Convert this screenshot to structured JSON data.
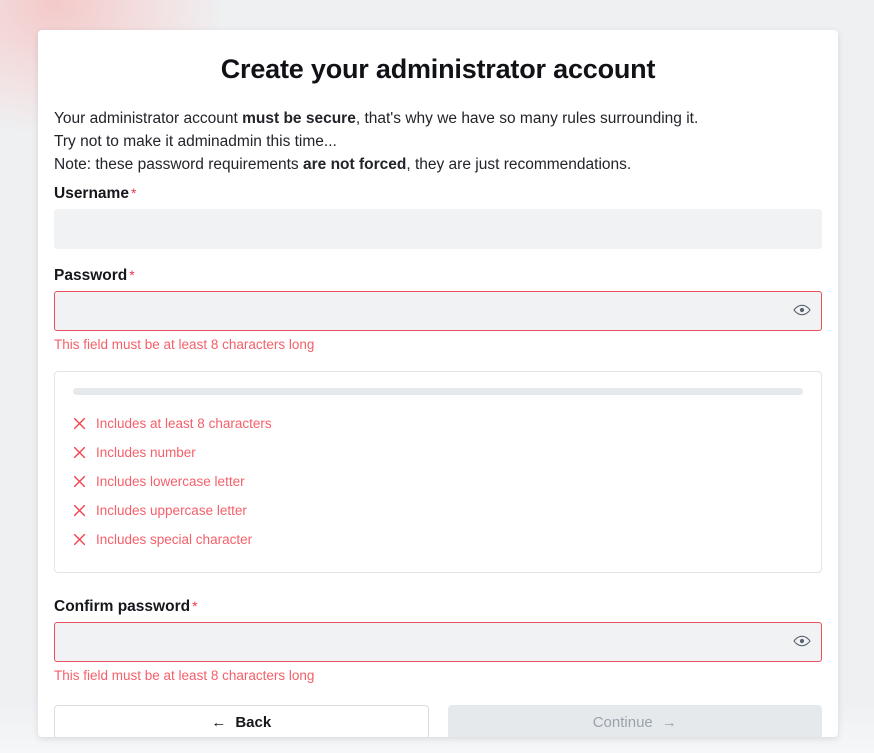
{
  "page": {
    "background_color": "#eef0f2",
    "accent_error_color": "#f4606a",
    "required_marker": "*"
  },
  "card": {
    "title": "Create your administrator account",
    "intro": {
      "line1_before": "Your administrator account ",
      "line1_bold": "must be secure",
      "line1_after": ", that's why we have so many rules surrounding it.",
      "line2": "Try not to make it adminadmin this time...",
      "line3_before": "Note: these password requirements ",
      "line3_bold": "are not forced",
      "line3_after": ", they are just recommendations."
    },
    "fields": {
      "username": {
        "label": "Username",
        "value": "",
        "placeholder": ""
      },
      "password": {
        "label": "Password",
        "value": "",
        "placeholder": "",
        "error": "This field must be at least 8 characters long",
        "toggle_icon": "eye-icon"
      },
      "confirm_password": {
        "label": "Confirm password",
        "value": "",
        "placeholder": "",
        "error": "This field must be at least 8 characters long",
        "toggle_icon": "eye-icon"
      }
    },
    "password_requirements": {
      "strength_percent": 0,
      "items": [
        {
          "icon": "x-icon",
          "label": "Includes at least 8 characters",
          "met": false
        },
        {
          "icon": "x-icon",
          "label": "Includes number",
          "met": false
        },
        {
          "icon": "x-icon",
          "label": "Includes lowercase letter",
          "met": false
        },
        {
          "icon": "x-icon",
          "label": "Includes uppercase letter",
          "met": false
        },
        {
          "icon": "x-icon",
          "label": "Includes special character",
          "met": false
        }
      ]
    },
    "buttons": {
      "back": {
        "label": "Back",
        "icon": "arrow-left-icon",
        "arrow": "←",
        "disabled": false
      },
      "continue": {
        "label": "Continue",
        "icon": "arrow-right-icon",
        "arrow": "→",
        "disabled": true
      }
    }
  }
}
